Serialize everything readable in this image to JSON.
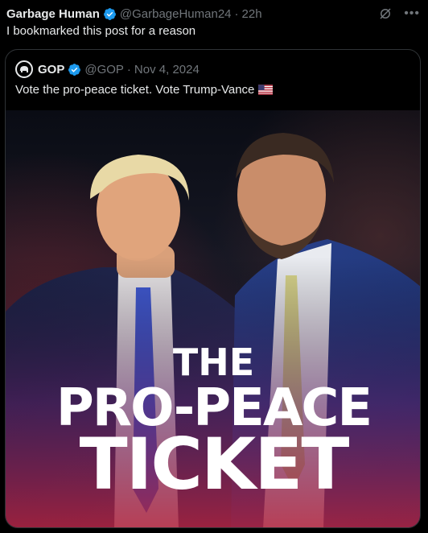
{
  "post": {
    "author_name": "Garbage Human",
    "handle": "@GarbageHuman24",
    "separator": "·",
    "time": "22h",
    "text": "I bookmarked this post for a reason"
  },
  "quote": {
    "author_name": "GOP",
    "handle": "@GOP",
    "separator": "·",
    "date": "Nov 4, 2024",
    "text": "Vote the pro-peace ticket. Vote Trump-Vance"
  },
  "media": {
    "headline_line1": "THE",
    "headline_line2": "PRO-PEACE",
    "headline_line3": "TICKET"
  },
  "icons": {
    "verified": "verified-badge-icon",
    "grok": "grok-icon",
    "more": "more-options-icon",
    "flag": "us-flag-icon",
    "gop_logo": "gop-elephant-icon"
  },
  "colors": {
    "background": "#000000",
    "text_primary": "#e7e9ea",
    "text_secondary": "#71767b",
    "verified_blue": "#1d9bf0",
    "border": "#2f3336"
  }
}
